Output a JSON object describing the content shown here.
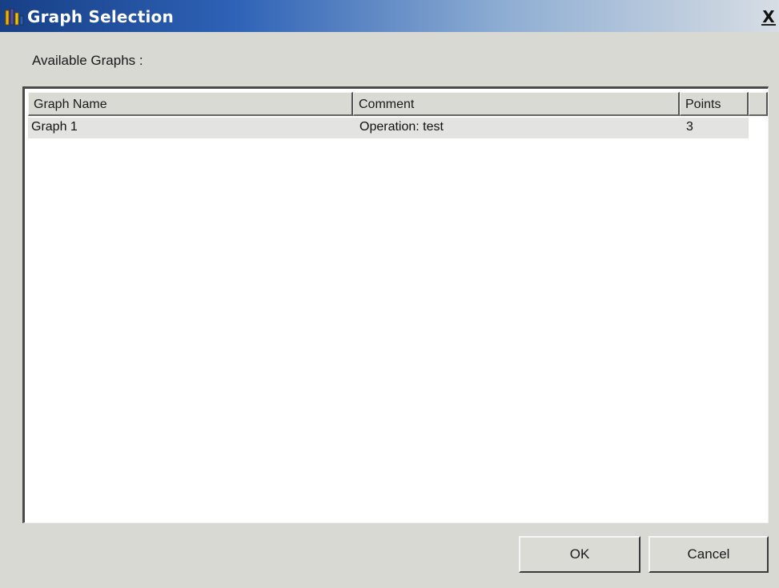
{
  "window": {
    "title": "Graph Selection",
    "close_glyph": "X"
  },
  "main": {
    "available_label": "Available Graphs :"
  },
  "table": {
    "columns": [
      "Graph Name",
      "Comment",
      "Points"
    ],
    "rows": [
      {
        "name": "Graph 1",
        "comment": "Operation: test",
        "points": "3"
      }
    ]
  },
  "buttons": {
    "ok": "OK",
    "cancel": "Cancel"
  },
  "colors": {
    "title_gradient_start": "#173f86",
    "dialog_bg": "#d7d9d2",
    "selected_row": "#e3e4e1"
  }
}
